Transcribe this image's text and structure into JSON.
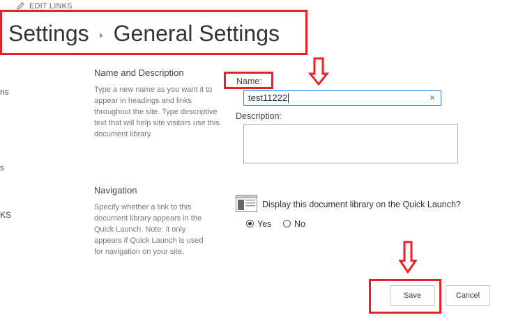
{
  "top_links": {
    "edit_links": "EDIT LINKS"
  },
  "breadcrumb": {
    "parent": "Settings",
    "current": "General Settings"
  },
  "left_nav_fragments": [
    "ns",
    "s",
    "KS"
  ],
  "name_description": {
    "title": "Name and Description",
    "description": "Type a new name as you want it to appear in headings and links throughout the site. Type descriptive text that will help site visitors use this document library.",
    "name_label": "Name:",
    "name_value": "test11222",
    "description_label": "Description:",
    "description_value": ""
  },
  "navigation": {
    "title": "Navigation",
    "description": "Specify whether a link to this document library appears in the Quick Launch. Note: it only appears if Quick Launch is used for navigation on your site.",
    "question": "Display this document library on the Quick Launch?",
    "options": [
      {
        "label": "Yes",
        "selected": true
      },
      {
        "label": "No",
        "selected": false
      }
    ]
  },
  "buttons": {
    "save": "Save",
    "cancel": "Cancel"
  },
  "annotation_color": "#e8202a",
  "icons": [
    "pencil-icon",
    "clear-icon",
    "quick-launch-icon",
    "arrow-down-icon"
  ]
}
